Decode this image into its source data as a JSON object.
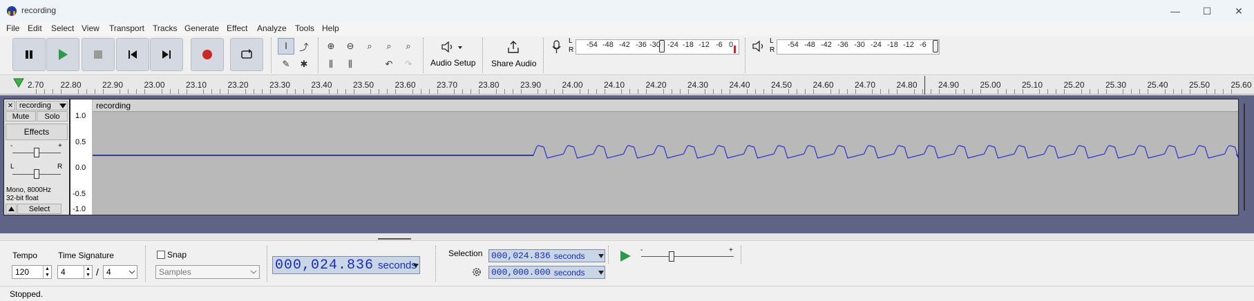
{
  "window": {
    "title": "recording",
    "minimize_glyph": "—",
    "maximize_glyph": "☐",
    "close_glyph": "✕"
  },
  "menu": [
    "File",
    "Edit",
    "Select",
    "View",
    "Transport",
    "Tracks",
    "Generate",
    "Effect",
    "Analyze",
    "Tools",
    "Help"
  ],
  "toolbar": {
    "audio_setup_label": "Audio Setup",
    "share_audio_label": "Share Audio",
    "record_meter_scale": [
      "-54",
      "-48",
      "-42",
      "-36",
      "-30",
      "-24",
      "-18",
      "-12",
      "-6",
      "0"
    ],
    "play_meter_scale": [
      "-54",
      "-48",
      "-42",
      "-36",
      "-30",
      "-24",
      "-18",
      "-12",
      "-6"
    ],
    "lr": [
      "L",
      "R"
    ]
  },
  "ruler": {
    "ticks": [
      "2.70",
      "22.80",
      "22.90",
      "23.00",
      "23.10",
      "23.20",
      "23.30",
      "23.40",
      "23.50",
      "23.60",
      "23.70",
      "23.80",
      "23.90",
      "24.00",
      "24.10",
      "24.20",
      "24.30",
      "24.40",
      "24.50",
      "24.60",
      "24.70",
      "24.80",
      "24.90",
      "25.00",
      "25.10",
      "25.20",
      "25.30",
      "25.40",
      "25.50",
      "25.60"
    ]
  },
  "track": {
    "name": "recording",
    "clip_name": "recording",
    "mute_label": "Mute",
    "solo_label": "Solo",
    "effects_label": "Effects",
    "gain_minus": "-",
    "gain_plus": "+",
    "pan_left": "L",
    "pan_right": "R",
    "info_line1": "Mono, 8000Hz",
    "info_line2": "32-bit float",
    "select_label": "Select",
    "y_ticks": [
      "1.0",
      "0.5",
      "0.0",
      "-0.5",
      "-1.0"
    ]
  },
  "bottom": {
    "tempo_label": "Tempo",
    "tempo_value": "120",
    "time_sig_label": "Time Signature",
    "time_sig_num": "4",
    "time_sig_slash": "/",
    "time_sig_den": "4",
    "snap_label": "Snap",
    "snap_unit": "Samples",
    "main_time": "000,024.836",
    "main_time_unit": "seconds",
    "selection_label": "Selection",
    "sel_start": "000,024.836",
    "sel_end": "000,000.000",
    "sel_unit": "seconds",
    "speed_minus": "-",
    "speed_plus": "+"
  },
  "status": {
    "text": "Stopped."
  },
  "colors": {
    "waveform": "#2f35c8",
    "record": "#c82828",
    "play": "#2d9a4a",
    "track_bg": "#5f6385",
    "accent": "#1a2bb0"
  },
  "icons": [
    "audacity-logo-icon",
    "pause-icon",
    "play-icon",
    "stop-icon",
    "skip-start-icon",
    "skip-end-icon",
    "record-icon",
    "loop-icon",
    "ibeam-tool-icon",
    "envelope-tool-icon",
    "draw-tool-icon",
    "multi-tool-icon",
    "zoom-in-icon",
    "zoom-out-icon",
    "fit-selection-icon",
    "fit-project-icon",
    "zoom-toggle-icon",
    "trim-icon",
    "silence-icon",
    "undo-icon",
    "redo-icon",
    "speaker-icon",
    "share-icon",
    "microphone-icon",
    "playback-speaker-icon",
    "gear-icon",
    "play-at-speed-icon"
  ]
}
